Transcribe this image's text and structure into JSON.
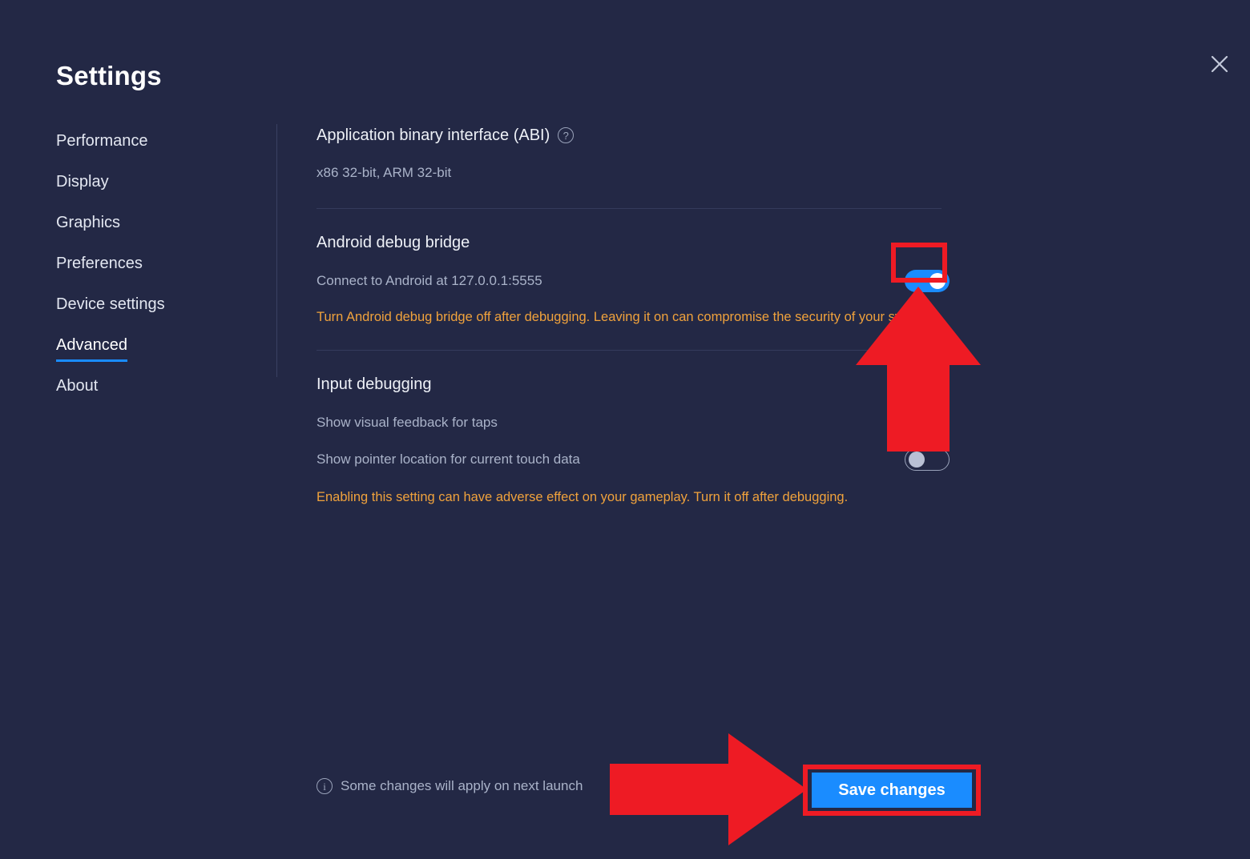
{
  "window": {
    "title": "Settings",
    "close_icon": "close-icon"
  },
  "sidebar": {
    "items": [
      {
        "label": "Performance",
        "active": false
      },
      {
        "label": "Display",
        "active": false
      },
      {
        "label": "Graphics",
        "active": false
      },
      {
        "label": "Preferences",
        "active": false
      },
      {
        "label": "Device settings",
        "active": false
      },
      {
        "label": "Advanced",
        "active": true
      },
      {
        "label": "About",
        "active": false
      }
    ],
    "active_underline_color": "#1a8cff"
  },
  "content": {
    "abi": {
      "title": "Application binary interface (ABI)",
      "help_icon": "help-circle-icon",
      "value": "x86 32-bit, ARM 32-bit"
    },
    "adb": {
      "title": "Android debug bridge",
      "description": "Connect to Android at 127.0.0.1:5555",
      "warning": "Turn Android debug bridge off after debugging. Leaving it on can compromise the security of your system.",
      "toggle_state": "on"
    },
    "input_debugging": {
      "title": "Input debugging",
      "option_taps": "Show visual feedback for taps",
      "option_taps_toggle_state": "off",
      "option_pointer": "Show pointer location for current touch data",
      "option_pointer_toggle_state": "off",
      "warning": "Enabling this setting can have adverse effect on your gameplay. Turn it off after  debugging."
    }
  },
  "footer": {
    "info_icon": "info-circle-icon",
    "note": "Some changes will apply on next launch",
    "save_label": "Save changes"
  },
  "annotations": {
    "highlight_color": "#ee1b24",
    "arrow_up_target": "adb-toggle",
    "arrow_right_target": "save-changes-button"
  },
  "colors": {
    "background": "#232845",
    "accent_blue": "#1a8cff",
    "warning_orange": "#f0a23c",
    "secondary_text": "#aab3c9",
    "primary_text": "#eef1f7"
  }
}
